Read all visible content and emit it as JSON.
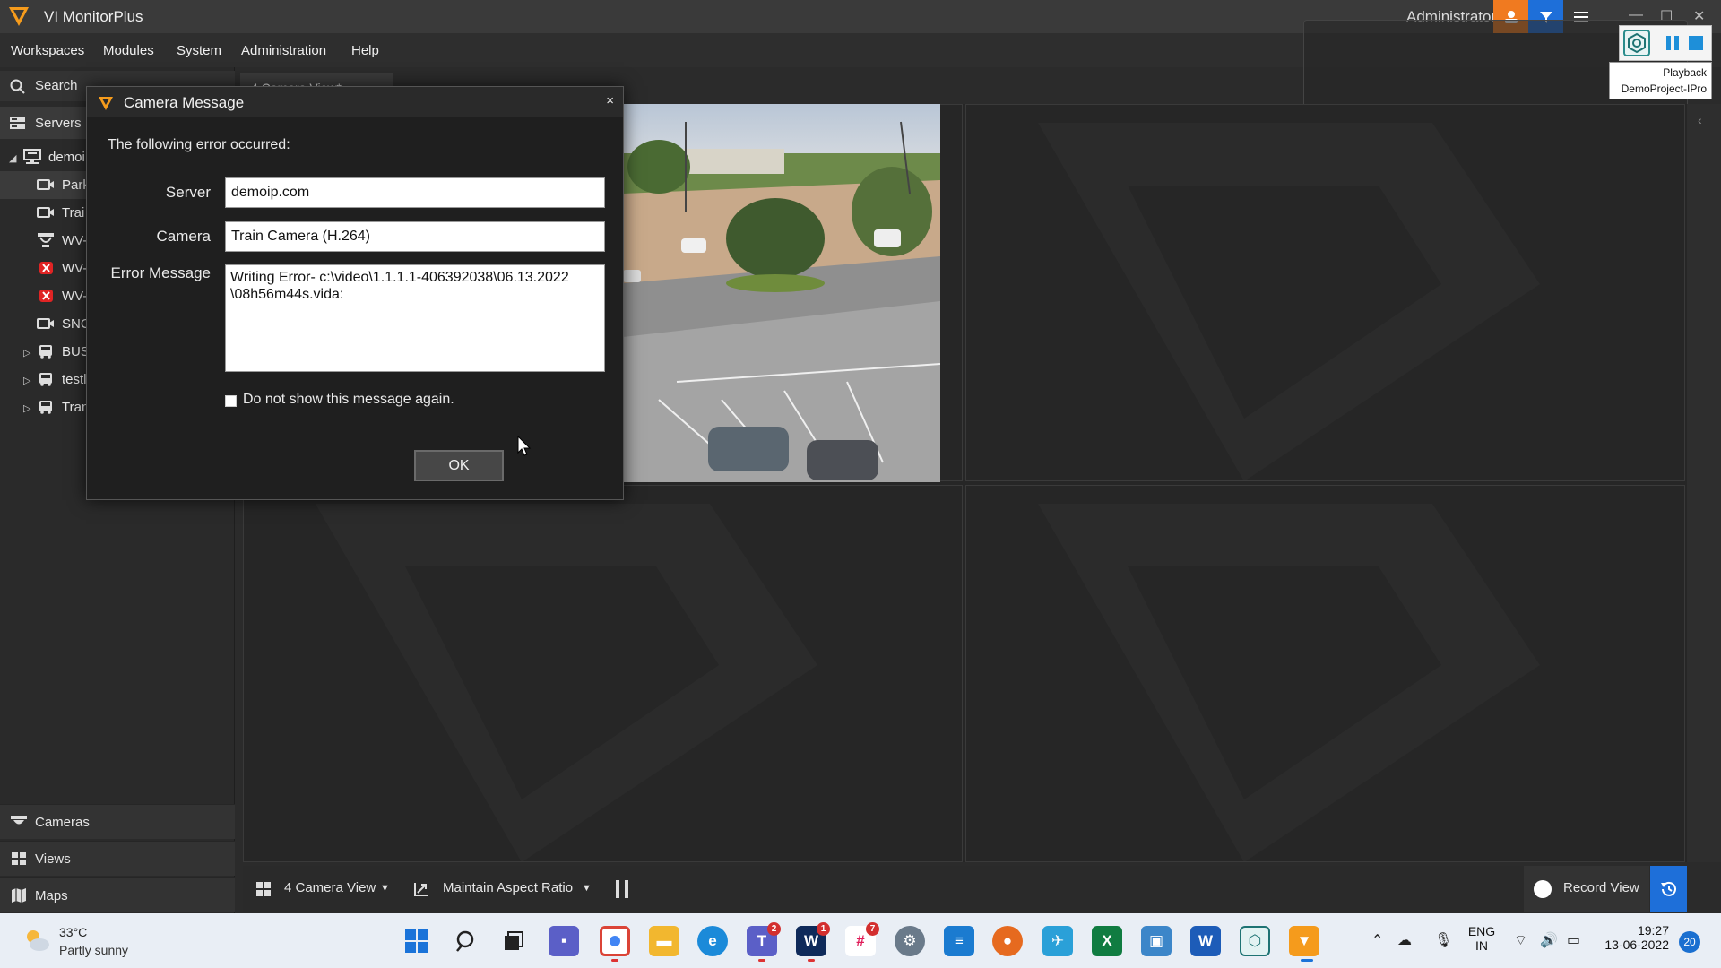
{
  "titlebar": {
    "app_title": "VI MonitorPlus",
    "user": "Administrator"
  },
  "menu": {
    "items": [
      "Workspaces",
      "Modules",
      "System",
      "Administration",
      "Help"
    ]
  },
  "sidebar": {
    "search_label": "Search",
    "servers_label": "Servers",
    "tree": [
      {
        "label": "demoi",
        "kind": "server"
      },
      {
        "label": "Park",
        "kind": "camera"
      },
      {
        "label": "Trai",
        "kind": "camera"
      },
      {
        "label": "WV-",
        "kind": "camera-360"
      },
      {
        "label": "WV-",
        "kind": "camera-error"
      },
      {
        "label": "WV-",
        "kind": "camera-error"
      },
      {
        "label": "SNC",
        "kind": "camera"
      },
      {
        "label": "BUS",
        "kind": "group"
      },
      {
        "label": "testl",
        "kind": "group"
      },
      {
        "label": "Tran",
        "kind": "group"
      }
    ],
    "bottom": {
      "cameras": "Cameras",
      "views": "Views",
      "maps": "Maps"
    }
  },
  "tabs": {
    "active": "4 Camera View*"
  },
  "playback_panel": {
    "tooltip_line1": "Playback",
    "tooltip_line2": "DemoProject-IPro"
  },
  "bottombar": {
    "view_selector": "4 Camera View",
    "aspect": "Maintain Aspect Ratio",
    "record_view": "Record View"
  },
  "dialog": {
    "title": "Camera Message",
    "close": "×",
    "intro": "The following error occurred:",
    "server_label": "Server",
    "server_value": "demoip.com",
    "camera_label": "Camera",
    "camera_value": "Train Camera (H.264)",
    "error_label": "Error Message",
    "error_value": "Writing Error- c:\\video\\1.1.1.1-406392038\\06.13.2022\n\\08h56m44s.vida:",
    "checkbox_label": "Do not show this message again.",
    "ok_label": "OK"
  },
  "taskbar": {
    "weather_temp": "33°C",
    "weather_cond": "Partly sunny",
    "badges": {
      "teams": "2",
      "wavebox": "1",
      "slack": "7"
    },
    "lang_top": "ENG",
    "lang_bottom": "IN",
    "time": "19:27",
    "date": "13-06-2022",
    "notifications": "20"
  },
  "colors": {
    "accent_orange": "#f07a20",
    "accent_blue": "#1e6fd9",
    "background": "#262626"
  }
}
